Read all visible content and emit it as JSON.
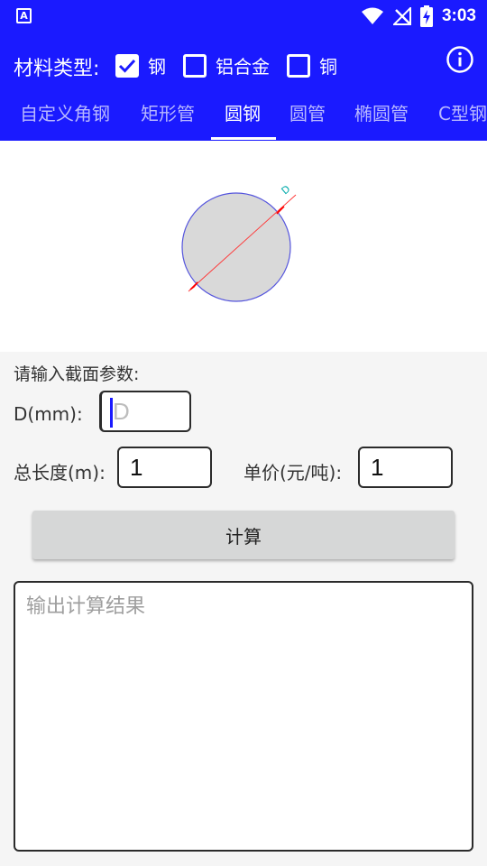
{
  "status_bar": {
    "app_icon": "A",
    "time": "3:03",
    "icons": [
      "wifi-icon",
      "no-signal-icon",
      "battery-charging-icon"
    ]
  },
  "material": {
    "label": "材料类型:",
    "options": [
      {
        "label": "钢",
        "checked": true
      },
      {
        "label": "铝合金",
        "checked": false
      },
      {
        "label": "铜",
        "checked": false
      }
    ],
    "info_icon": "info-icon"
  },
  "tabs": [
    {
      "label": "自定义角钢",
      "active": false
    },
    {
      "label": "矩形管",
      "active": false
    },
    {
      "label": "圆钢",
      "active": true
    },
    {
      "label": "圆管",
      "active": false
    },
    {
      "label": "椭圆管",
      "active": false
    },
    {
      "label": "C型钢",
      "active": false
    }
  ],
  "figure": {
    "dimension_label": "D"
  },
  "form": {
    "section_title": "请输入截面参数:",
    "diameter_label": "D(mm):",
    "diameter_placeholder": "D",
    "diameter_value": "",
    "length_label": "总长度(m):",
    "length_value": "1",
    "price_label": "单价(元/吨):",
    "price_value": "1",
    "calc_button": "计算",
    "output_placeholder": "输出计算结果"
  },
  "colors": {
    "primary": "#1a1aff",
    "tab_inactive": "#b8b8ff",
    "circle_fill": "#d9d9d9",
    "circle_stroke": "#5555dd",
    "dimension_line": "#ff3333",
    "dimension_text": "#00aaaa"
  }
}
